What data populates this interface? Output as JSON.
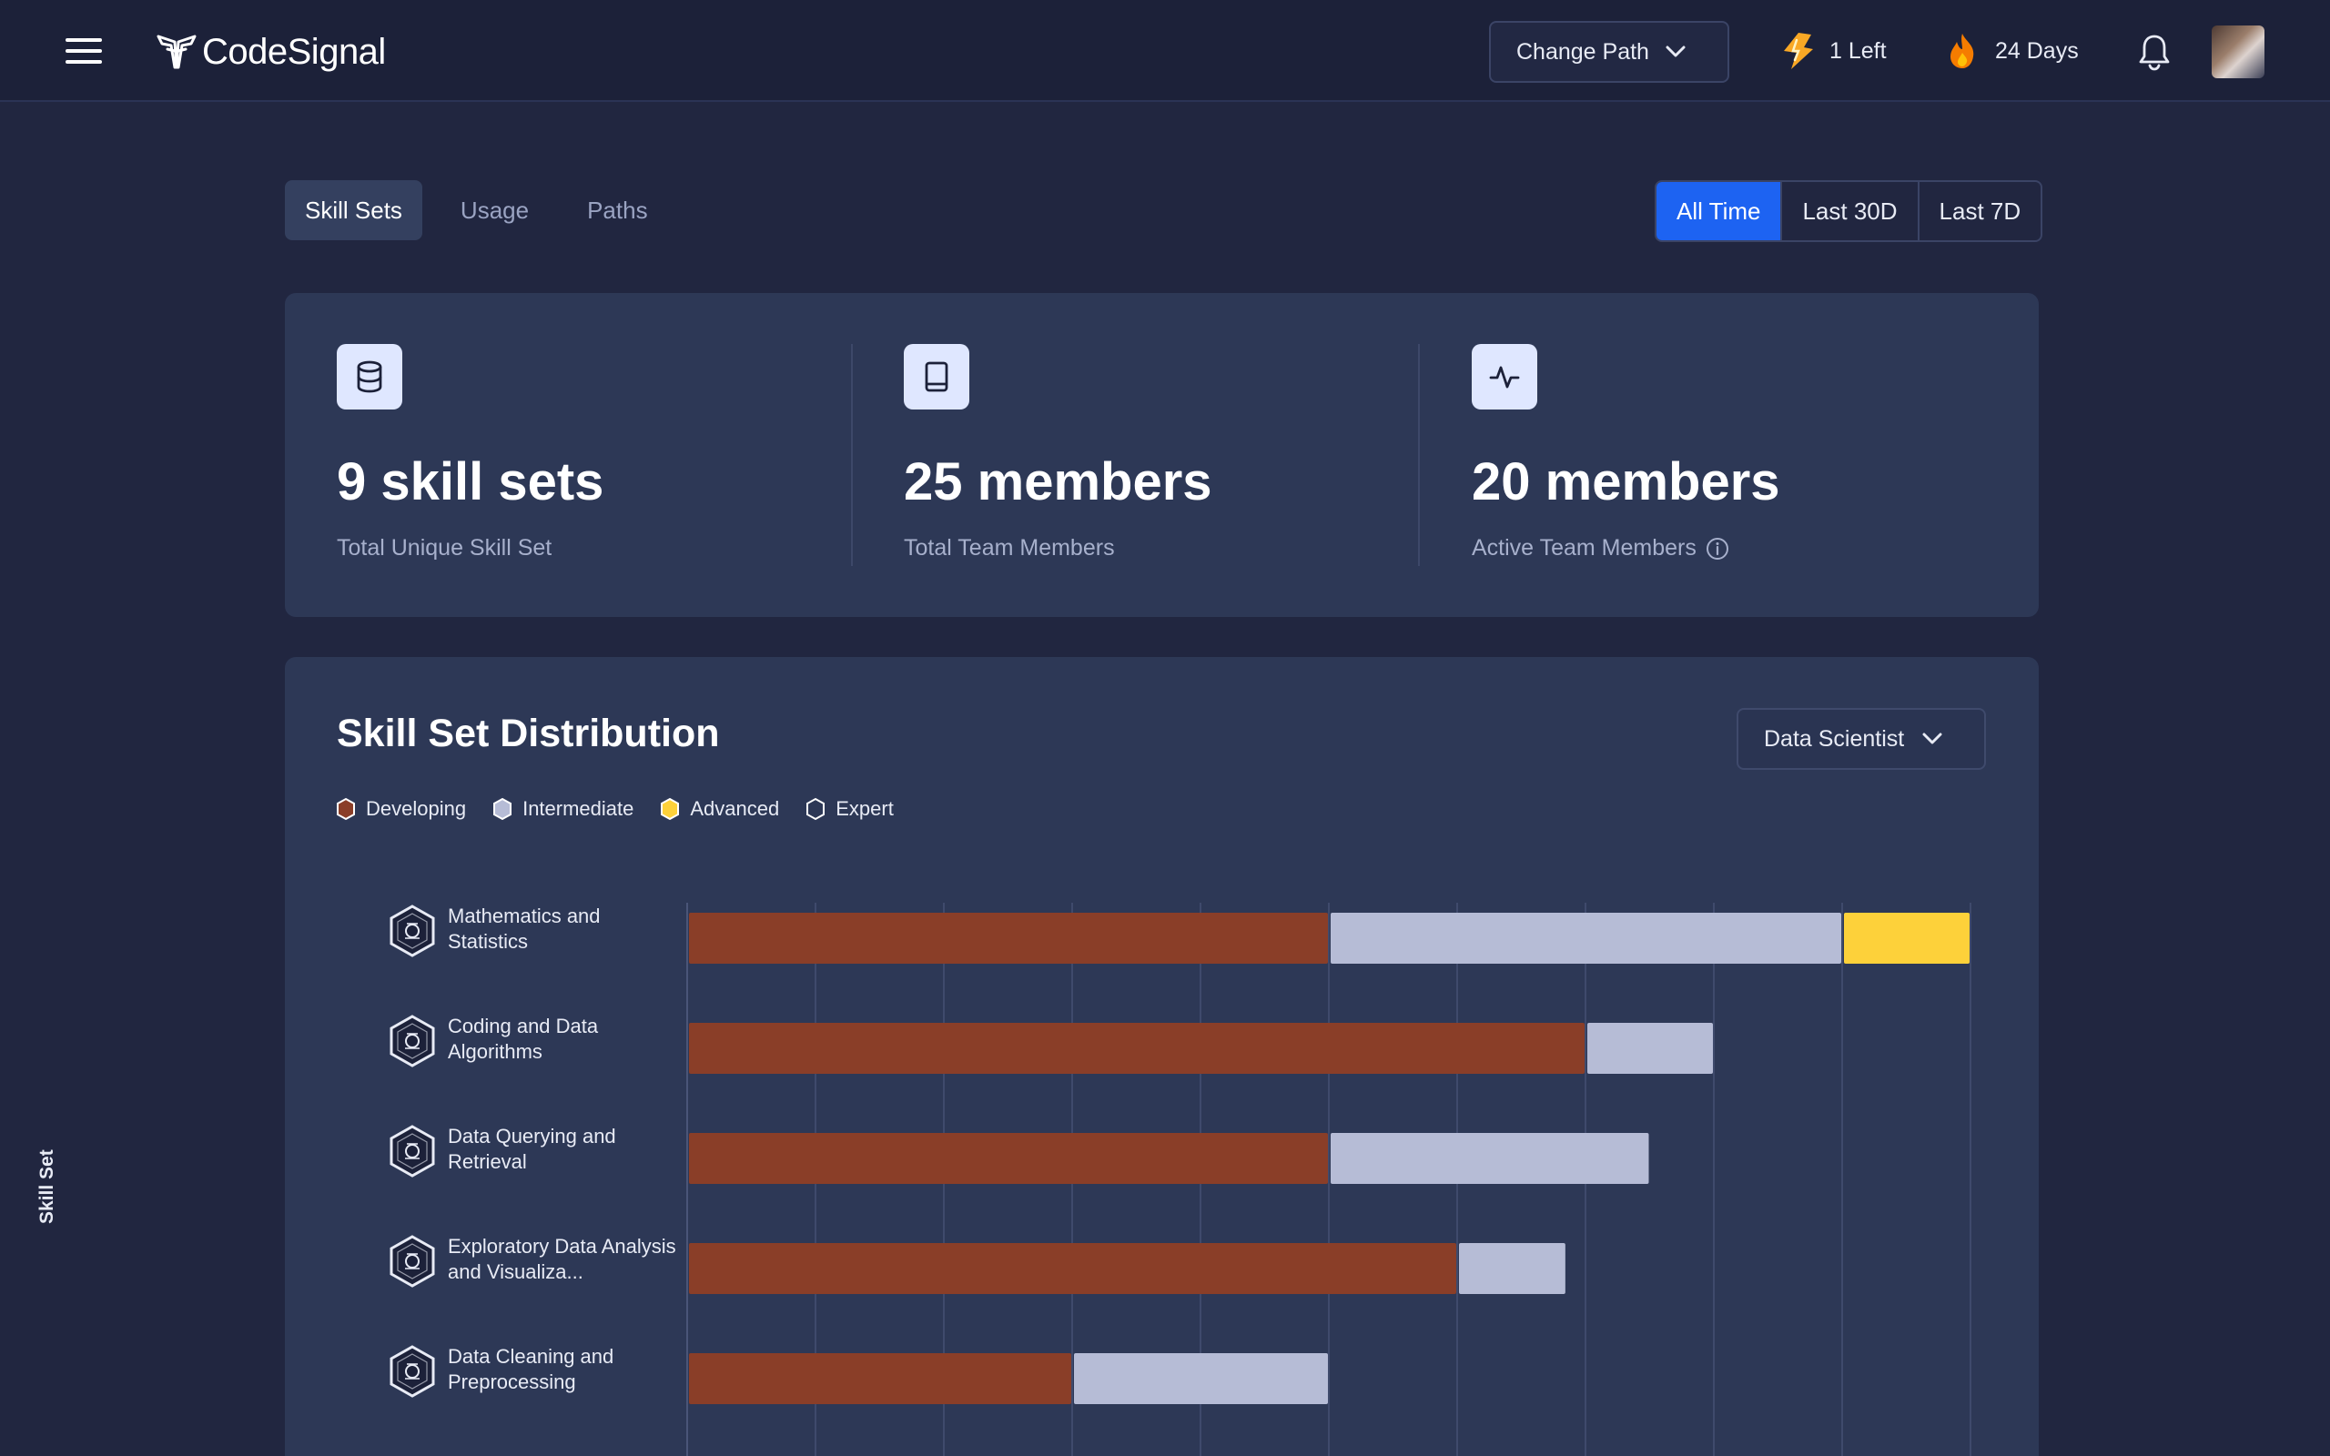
{
  "header": {
    "logo_text": "CodeSignal",
    "change_path_label": "Change Path",
    "energy_label": "1 Left",
    "streak_label": "24 Days"
  },
  "tabs": [
    {
      "label": "Skill Sets",
      "active": true
    },
    {
      "label": "Usage",
      "active": false
    },
    {
      "label": "Paths",
      "active": false
    }
  ],
  "time_range": [
    {
      "label": "All Time",
      "active": true
    },
    {
      "label": "Last 30D",
      "active": false
    },
    {
      "label": "Last 7D",
      "active": false
    }
  ],
  "summary": {
    "skill_sets": {
      "value": "9 skill sets",
      "label": "Total Unique Skill Set",
      "icon": "database-icon"
    },
    "team_members": {
      "value": "25 members",
      "label": "Total Team Members",
      "icon": "book-icon"
    },
    "active_members": {
      "value": "20 members",
      "label": "Active Team Members",
      "icon": "activity-icon"
    }
  },
  "distribution": {
    "title": "Skill Set Distribution",
    "role_select": "Data Scientist",
    "y_axis_title": "Skill Set"
  },
  "colors": {
    "developing": "#8a3e28",
    "intermediate": "#b6bcd6",
    "advanced": "#fdd13a",
    "expert": "#2d3856",
    "accent": "#1d63f2"
  },
  "chart_data": {
    "type": "bar",
    "orientation": "horizontal",
    "stacked": true,
    "legend": [
      "Developing",
      "Intermediate",
      "Advanced",
      "Expert"
    ],
    "legend_position": "top-left",
    "categories": [
      "Mathematics and Statistics",
      "Coding and Data Algorithms",
      "Data Querying and Retrieval",
      "Exploratory Data Analysis and Visualiza...",
      "Data Cleaning and Preprocessing"
    ],
    "series": [
      {
        "name": "Developing",
        "values": [
          5,
          7,
          5,
          6,
          3
        ]
      },
      {
        "name": "Intermediate",
        "values": [
          4,
          1,
          2.5,
          0.85,
          2
        ]
      },
      {
        "name": "Advanced",
        "values": [
          1,
          0,
          0,
          0,
          0
        ]
      },
      {
        "name": "Expert",
        "values": [
          0,
          0,
          0,
          0,
          0
        ]
      }
    ],
    "xlim": [
      0,
      10
    ],
    "grid": true,
    "ylabel": "Skill Set"
  }
}
